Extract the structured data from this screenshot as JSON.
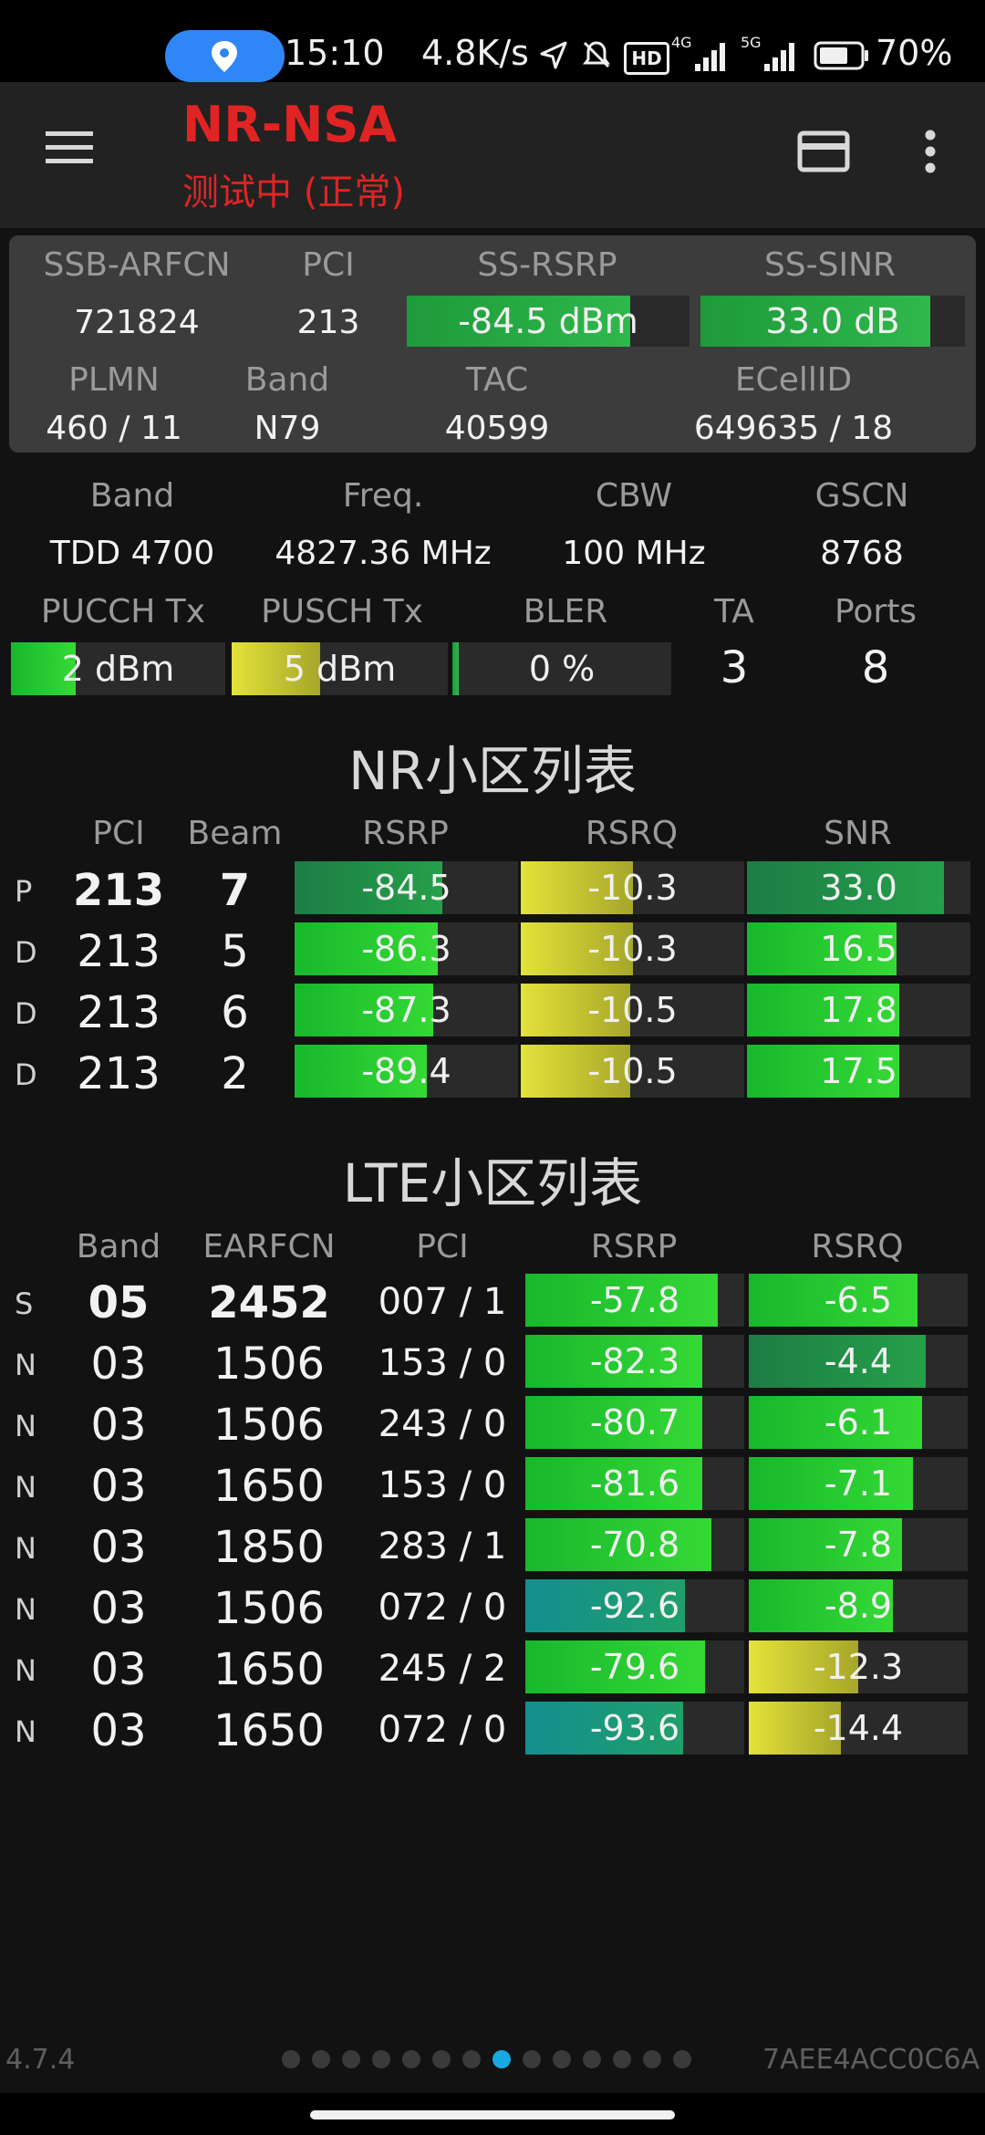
{
  "status_bar": {
    "time": "15:10",
    "speed": "4.8K/s",
    "hd_badge": "HD",
    "battery": "70%"
  },
  "app": {
    "title": "NR-NSA",
    "status": "测试中 (正常)"
  },
  "serving_panel": {
    "row1_labels": [
      "SSB-ARFCN",
      "PCI",
      "SS-RSRP",
      "SS-SINR"
    ],
    "ssb_arfcn": "721824",
    "pci": "213",
    "ss_rsrp": "-84.5 dBm",
    "ss_rsrp_fill": 0.79,
    "ss_sinr": "33.0 dB",
    "ss_sinr_fill": 0.87,
    "row2_labels": [
      "PLMN",
      "Band",
      "TAC",
      "ECellID"
    ],
    "plmn": "460 / 11",
    "band": "N79",
    "tac": "40599",
    "ecellid": "649635 / 18"
  },
  "details": {
    "labels1": [
      "Band",
      "Freq.",
      "CBW",
      "GSCN"
    ],
    "band": "TDD 4700",
    "freq": "4827.36 MHz",
    "cbw": "100 MHz",
    "gscn": "8768",
    "labels2": [
      "PUCCH Tx",
      "PUSCH Tx",
      "BLER",
      "TA",
      "Ports"
    ],
    "pucch_tx": "2 dBm",
    "pucch_fill": 0.3,
    "pusch_tx": "5 dBm",
    "pusch_fill": 0.41,
    "bler": "0 %",
    "bler_fill": 0.03,
    "ta": "3",
    "ports": "8"
  },
  "nr_list": {
    "title": "NR小区列表",
    "headers": [
      "PCI",
      "Beam",
      "RSRP",
      "RSRQ",
      "SNR"
    ],
    "rows": [
      {
        "type": "P",
        "pci": "213",
        "beam": "7",
        "rsrp": "-84.5",
        "rsrp_fill": 0.66,
        "rsrp_color": "dark",
        "rsrq": "-10.3",
        "rsrq_fill": 0.5,
        "snr": "33.0",
        "snr_fill": 0.88,
        "snr_color": "dark"
      },
      {
        "type": "D",
        "pci": "213",
        "beam": "5",
        "rsrp": "-86.3",
        "rsrp_fill": 0.64,
        "rsrp_color": "bright",
        "rsrq": "-10.3",
        "rsrq_fill": 0.5,
        "snr": "16.5",
        "snr_fill": 0.67,
        "snr_color": "bright"
      },
      {
        "type": "D",
        "pci": "213",
        "beam": "6",
        "rsrp": "-87.3",
        "rsrp_fill": 0.62,
        "rsrp_color": "bright",
        "rsrq": "-10.5",
        "rsrq_fill": 0.49,
        "snr": "17.8",
        "snr_fill": 0.68,
        "snr_color": "bright"
      },
      {
        "type": "D",
        "pci": "213",
        "beam": "2",
        "rsrp": "-89.4",
        "rsrp_fill": 0.59,
        "rsrp_color": "bright",
        "rsrq": "-10.5",
        "rsrq_fill": 0.49,
        "snr": "17.5",
        "snr_fill": 0.68,
        "snr_color": "bright"
      }
    ]
  },
  "lte_list": {
    "title": "LTE小区列表",
    "headers": [
      "Band",
      "EARFCN",
      "PCI",
      "RSRP",
      "RSRQ"
    ],
    "rows": [
      {
        "type": "S",
        "band": "05",
        "earfcn": "2452",
        "pci": "007 / 1",
        "rsrp": "-57.8",
        "rsrp_fill": 0.88,
        "rsrp_color": "bright",
        "rsrq": "-6.5",
        "rsrq_fill": 0.77,
        "rsrq_color": "bright"
      },
      {
        "type": "N",
        "band": "03",
        "earfcn": "1506",
        "pci": "153 / 0",
        "rsrp": "-82.3",
        "rsrp_fill": 0.81,
        "rsrp_color": "bright",
        "rsrq": "-4.4",
        "rsrq_fill": 0.81,
        "rsrq_color": "dark"
      },
      {
        "type": "N",
        "band": "03",
        "earfcn": "1506",
        "pci": "243 / 0",
        "rsrp": "-80.7",
        "rsrp_fill": 0.81,
        "rsrp_color": "bright",
        "rsrq": "-6.1",
        "rsrq_fill": 0.79,
        "rsrq_color": "bright"
      },
      {
        "type": "N",
        "band": "03",
        "earfcn": "1650",
        "pci": "153 / 0",
        "rsrp": "-81.6",
        "rsrp_fill": 0.81,
        "rsrp_color": "bright",
        "rsrq": "-7.1",
        "rsrq_fill": 0.75,
        "rsrq_color": "bright"
      },
      {
        "type": "N",
        "band": "03",
        "earfcn": "1850",
        "pci": "283 / 1",
        "rsrp": "-70.8",
        "rsrp_fill": 0.85,
        "rsrp_color": "bright",
        "rsrq": "-7.8",
        "rsrq_fill": 0.7,
        "rsrq_color": "bright"
      },
      {
        "type": "N",
        "band": "03",
        "earfcn": "1506",
        "pci": "072 / 0",
        "rsrp": "-92.6",
        "rsrp_fill": 0.73,
        "rsrp_color": "teal",
        "rsrq": "-8.9",
        "rsrq_fill": 0.66,
        "rsrq_color": "bright"
      },
      {
        "type": "N",
        "band": "03",
        "earfcn": "1650",
        "pci": "245 / 2",
        "rsrp": "-79.6",
        "rsrp_fill": 0.82,
        "rsrp_color": "bright",
        "rsrq": "-12.3",
        "rsrq_fill": 0.5,
        "rsrq_color": "yellow"
      },
      {
        "type": "N",
        "band": "03",
        "earfcn": "1650",
        "pci": "072 / 0",
        "rsrp": "-93.6",
        "rsrp_fill": 0.72,
        "rsrp_color": "teal",
        "rsrq": "-14.4",
        "rsrq_fill": 0.42,
        "rsrq_color": "yellow"
      }
    ]
  },
  "footer": {
    "version": "4.7.4",
    "device_id": "7AEE4ACC0C6A",
    "page_count": 14,
    "active_page": 8
  },
  "colors": {
    "title_red": "#e02424",
    "accent_blue": "#19a8e0",
    "panel_bg": "#3c3c3c"
  }
}
